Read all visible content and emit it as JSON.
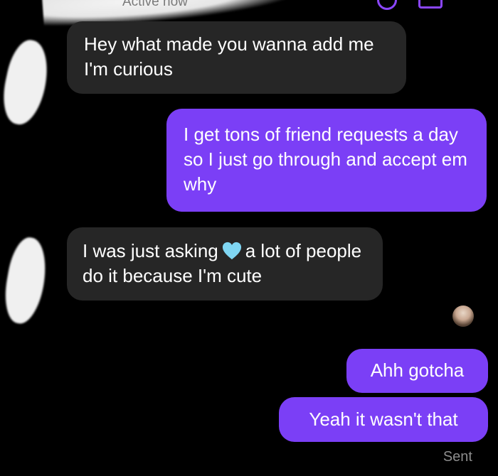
{
  "header": {
    "status": "Active now"
  },
  "messages": [
    {
      "direction": "incoming",
      "text": "Hey what made you wanna add me I'm curious"
    },
    {
      "direction": "outgoing",
      "text": "I get tons of friend requests a day so I just go through and accept em why"
    },
    {
      "direction": "incoming",
      "text_before": "I was just asking",
      "emoji": "light-blue-heart",
      "text_after": "a lot of people do it because I'm cute"
    },
    {
      "direction": "outgoing",
      "text": "Ahh gotcha"
    },
    {
      "direction": "outgoing",
      "text": "Yeah it wasn't that"
    }
  ],
  "read_status": "Sent",
  "colors": {
    "background": "#000000",
    "incoming_bubble": "#262626",
    "outgoing_bubble": "#7b3ff6",
    "heart": "#7fd6f3"
  }
}
